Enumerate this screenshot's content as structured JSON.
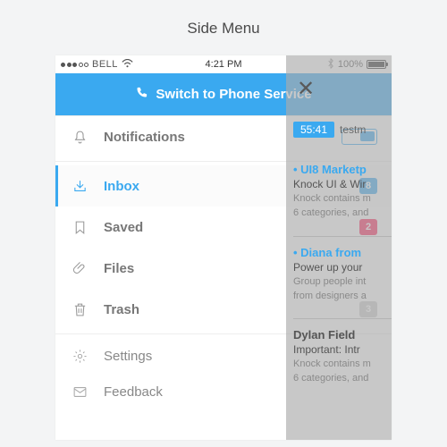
{
  "page": {
    "title": "Side Menu"
  },
  "status": {
    "carrier": "BELL",
    "time": "4:21 PM",
    "battery_pct": "100%"
  },
  "banner": {
    "label": "Switch to Phone Service"
  },
  "menu": {
    "notifications": {
      "label": "Notifications",
      "toggle_on": true
    },
    "inbox": {
      "label": "Inbox",
      "badge": "8"
    },
    "saved": {
      "label": "Saved",
      "badge": "2"
    },
    "files": {
      "label": "Files"
    },
    "trash": {
      "label": "Trash",
      "badge": "3"
    },
    "settings": {
      "label": "Settings"
    },
    "feedback": {
      "label": "Feedback"
    }
  },
  "overlay": {
    "time": "55:41",
    "user": "testm",
    "items": [
      {
        "title": "UI8 Marketp",
        "sub": "Knock UI & Wir",
        "desc1": "Knock contains m",
        "desc2": "6 categories, and"
      },
      {
        "title": "Diana from",
        "sub": "Power up your",
        "desc1": "Group people int",
        "desc2": "from designers a"
      },
      {
        "title": "Dylan Field",
        "sub": "Important: Intr",
        "desc1": "Knock contains m",
        "desc2": "6 categories, and"
      }
    ]
  },
  "colors": {
    "accent": "#3aa9f0",
    "danger": "#ff2860",
    "muted": "#cfcfcf"
  }
}
